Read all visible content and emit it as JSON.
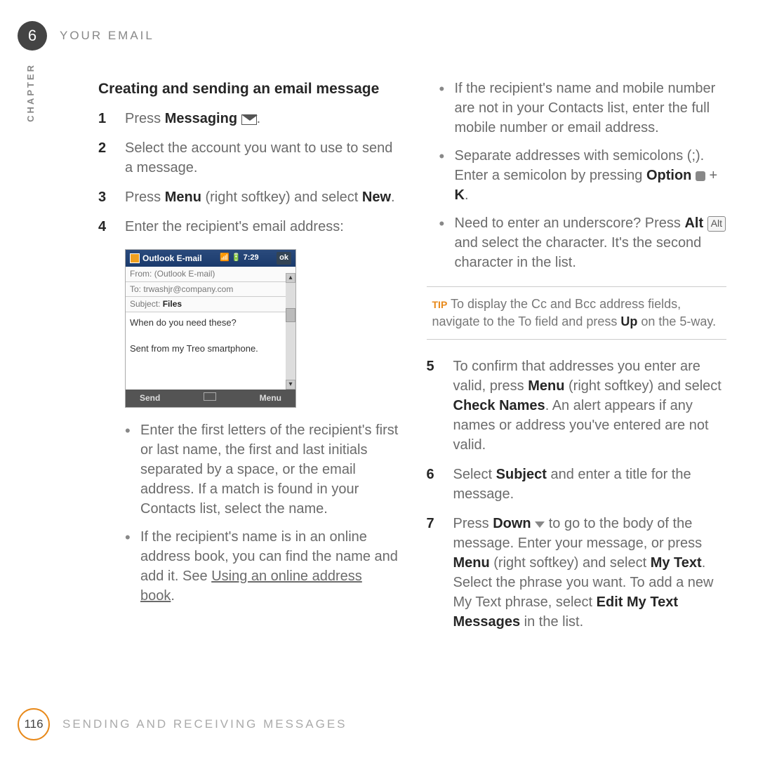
{
  "header": {
    "chapter_number": "6",
    "title": "YOUR EMAIL",
    "chapter_label": "CHAPTER"
  },
  "left": {
    "section_title": "Creating and sending an email message",
    "steps": [
      {
        "pre": "Press ",
        "bold": "Messaging",
        "post": " "
      },
      {
        "text": "Select the account you want to use to send a message."
      },
      {
        "pre": "Press ",
        "bold": "Menu",
        "mid": " (right softkey) and select ",
        "bold2": "New",
        "post": "."
      },
      {
        "text": "Enter the recipient's email address:"
      }
    ],
    "screenshot": {
      "title": "Outlook E-mail",
      "time": "7:29",
      "ok": "ok",
      "from_label": "From:",
      "from": "(Outlook E-mail)",
      "to_label": "To:",
      "to": "trwashjr@company.com",
      "subject_label": "Subject:",
      "subject": "Files",
      "body_line1": "When do you need these?",
      "body_line2": "Sent from my Treo smartphone.",
      "footer_left": "Send",
      "footer_right": "Menu"
    },
    "bullets": [
      "Enter the first letters of the recipient's first or last name, the first and last initials separated by a space, or the email address. If a match is found in your Contacts list, select the name.",
      {
        "pre": "If the recipient's name is in an online address book, you can find the name and add it. See ",
        "link": "Using an online address book",
        "post": "."
      }
    ]
  },
  "right": {
    "bullets": [
      "If the recipient's name and mobile number are not in your Contacts list, enter the full mobile number or email address.",
      {
        "pre": "Separate addresses with semicolons (;). Enter a semicolon by pressing ",
        "bold": "Option",
        "mid": " ",
        "post_bold": " + ",
        "bold2": "K",
        "post": "."
      },
      {
        "pre": "Need to enter an underscore? Press ",
        "bold": "Alt",
        "mid": " ",
        "alt_key": "Alt",
        "post": " and select the character. It's the second character in the list."
      }
    ],
    "tip": {
      "label": "TIP",
      "pre": " To display the Cc and Bcc address fields, navigate to the To field and press ",
      "bold": "Up",
      "post": " on the 5-way."
    },
    "steps2": [
      {
        "n": "5",
        "pre": "To confirm that addresses you enter are valid, press ",
        "bold": "Menu",
        "mid": " (right softkey) and select ",
        "bold2": "Check Names",
        "post": ". An alert appears if any names or address you've entered are not valid."
      },
      {
        "n": "6",
        "pre": "Select ",
        "bold": "Subject",
        "post": " and enter a title for the message."
      },
      {
        "n": "7",
        "pre": "Press ",
        "bold": "Down",
        "mid": " ",
        "post1": " to go to the body of the message. Enter your message, or press ",
        "bold2": "Menu",
        "mid2": " (right softkey) and select ",
        "bold3": "My Text",
        "post2": ". Select the phrase you want. To add a new My Text phrase, select ",
        "bold4": "Edit My Text Messages",
        "post3": " in the list."
      }
    ]
  },
  "footer": {
    "page": "116",
    "text": "SENDING AND RECEIVING MESSAGES"
  }
}
